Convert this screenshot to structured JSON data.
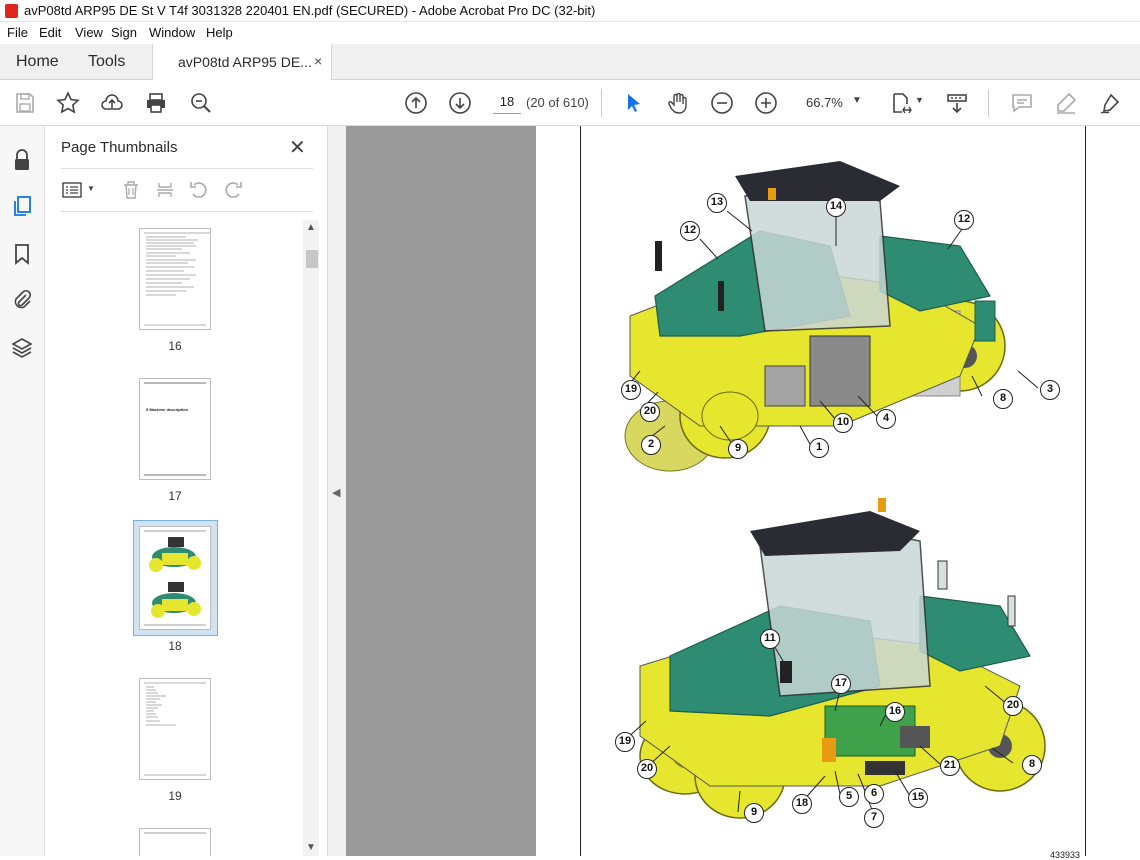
{
  "window": {
    "title": "avP08td ARP95 DE St V T4f 3031328 220401 EN.pdf (SECURED) - Adobe Acrobat Pro DC (32-bit)"
  },
  "menu": {
    "items": [
      "File",
      "Edit",
      "View",
      "Sign",
      "Window",
      "Help"
    ]
  },
  "tabs": {
    "home": "Home",
    "tools": "Tools",
    "document": "avP08td ARP95 DE...",
    "close": "×"
  },
  "toolbar": {
    "page_number": "18",
    "page_count": "(20 of 610)",
    "zoom": "66.7%"
  },
  "thumbnails": {
    "title": "Page Thumbnails",
    "close": "✕",
    "pages": [
      {
        "number": "16"
      },
      {
        "number": "17",
        "heading": "5 Machine description"
      },
      {
        "number": "18",
        "selected": true
      },
      {
        "number": "19"
      }
    ]
  },
  "document": {
    "callouts_top": [
      "13",
      "14",
      "12",
      "12",
      "3",
      "8",
      "4",
      "10",
      "1",
      "9",
      "2",
      "20",
      "19"
    ],
    "callouts_bottom": [
      "11",
      "17",
      "16",
      "20",
      "8",
      "21",
      "15",
      "7",
      "6",
      "5",
      "18",
      "9",
      "20",
      "19"
    ],
    "figure_ref": "433933"
  },
  "colors": {
    "accent": "#1473e6",
    "machine_green": "#2e8c72",
    "machine_yellow": "#e6e62e"
  }
}
